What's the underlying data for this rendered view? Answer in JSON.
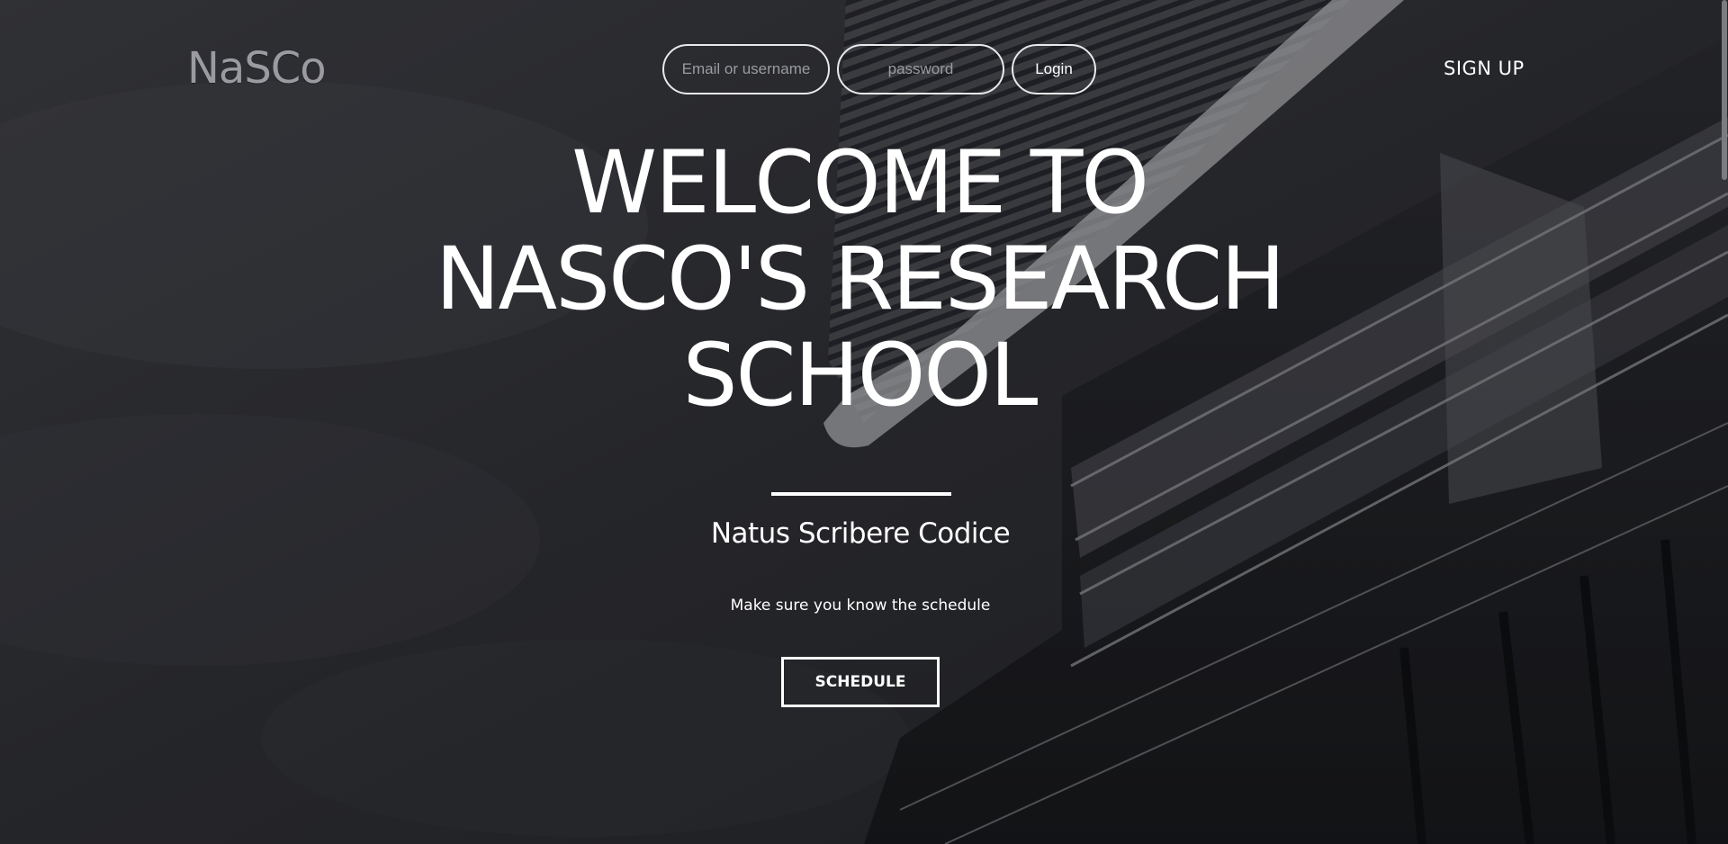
{
  "brand": {
    "logo_text": "NaSCo"
  },
  "login": {
    "email_placeholder": "Email or username",
    "password_placeholder": "password",
    "login_label": "Login"
  },
  "nav": {
    "signup_label": "SIGN UP"
  },
  "hero": {
    "headline_lines": [
      "WELCOME TO",
      "NASCO'S RESEARCH",
      "SCHOOL"
    ],
    "tagline": "Natus Scribere Codice",
    "subline": "Make sure you know the schedule",
    "cta_label": "SCHEDULE"
  },
  "colors": {
    "background_dark": "#2c2d31",
    "text_primary": "#ffffff",
    "logo_gray": "#9a9ba0",
    "input_border": "#e9e9ec"
  }
}
